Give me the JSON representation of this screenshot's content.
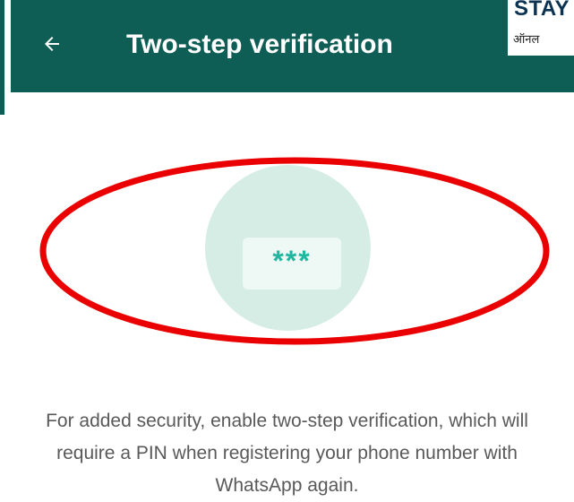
{
  "header": {
    "title": "Two-step verification",
    "back_icon": "back-arrow-icon",
    "color": "#0f5e55"
  },
  "watermark": {
    "top_text": "STAY",
    "sub_text": "ऑनल"
  },
  "hero": {
    "pin_mask": "***",
    "icon": "password-pin-icon",
    "circle_color": "#d6ede5",
    "mask_color": "#1fb79f"
  },
  "annotation": {
    "color": "#ea0000",
    "shape": "ellipse"
  },
  "description": {
    "text": "For added security, enable two-step verification, which will require a PIN when registering your phone number with WhatsApp again."
  }
}
